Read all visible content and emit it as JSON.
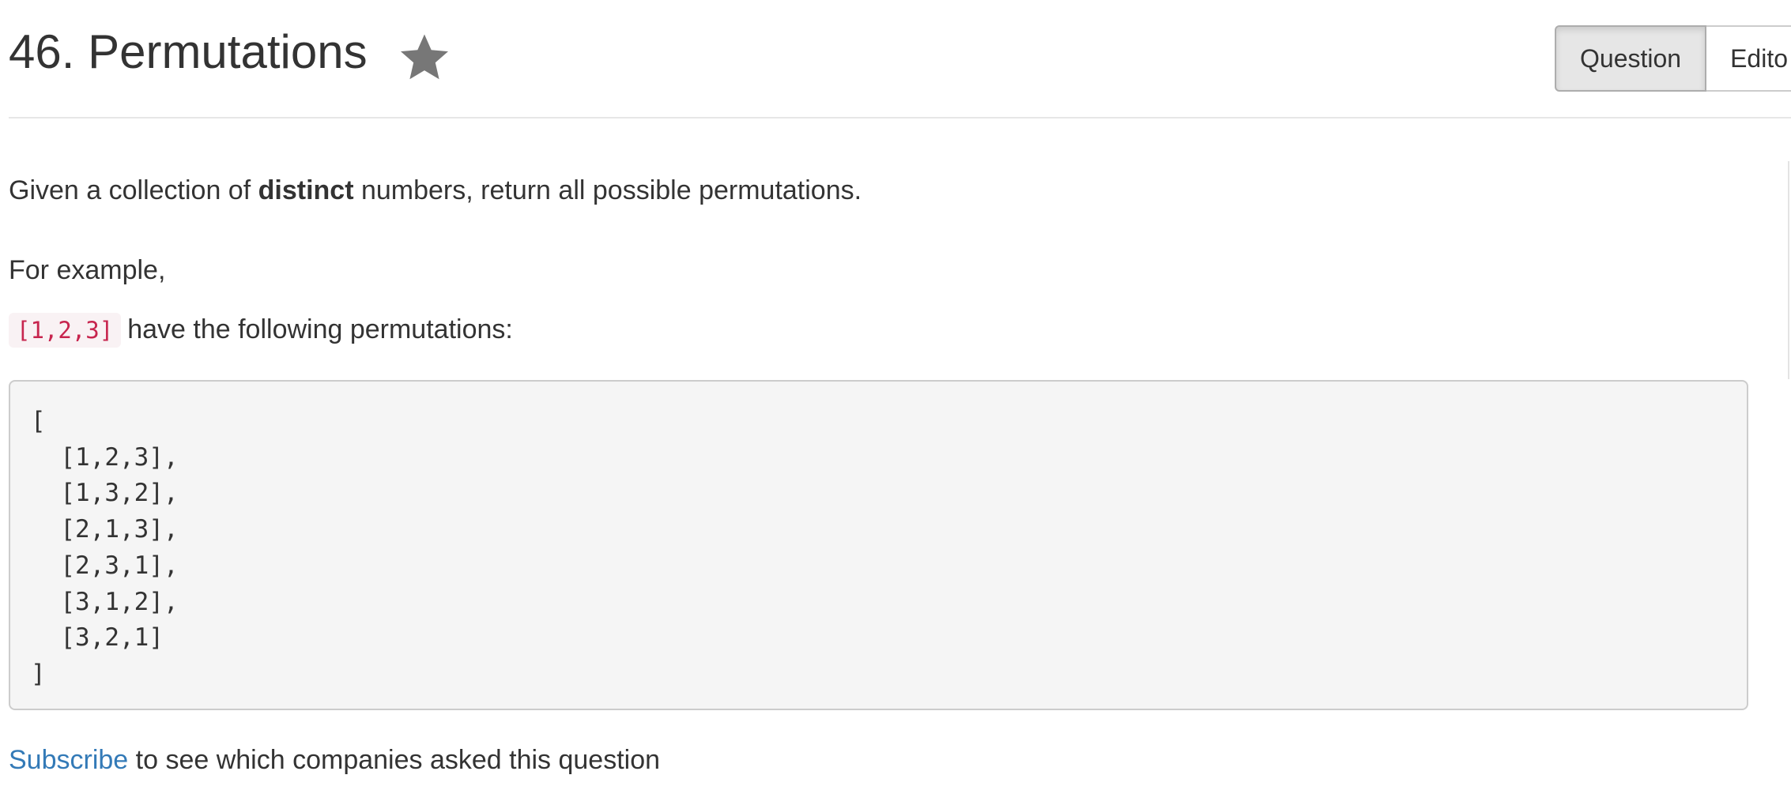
{
  "header": {
    "title": "46. Permutations",
    "star_icon": "star-icon",
    "tabs": [
      {
        "label": "Question",
        "active": true
      },
      {
        "label": "Edito",
        "active": false
      }
    ]
  },
  "problem": {
    "intro_before": "Given a collection of ",
    "intro_bold": "distinct",
    "intro_after": " numbers, return all possible permutations.",
    "example_label": "For example,",
    "example_code": "[1,2,3]",
    "example_text": "have the following permutations:",
    "code_lines": [
      "[",
      "  [1,2,3],",
      "  [1,3,2],",
      "  [2,1,3],",
      "  [2,3,1],",
      "  [3,1,2],",
      "  [3,2,1]",
      "]"
    ],
    "subscribe_link": "Subscribe",
    "subscribe_text": " to see which companies asked this question"
  },
  "colors": {
    "text": "#333333",
    "link": "#337ab7",
    "inline_code": "#c7254e",
    "inline_code_bg": "#f9f2f4",
    "code_bg": "#f5f5f5",
    "star": "#777777"
  }
}
